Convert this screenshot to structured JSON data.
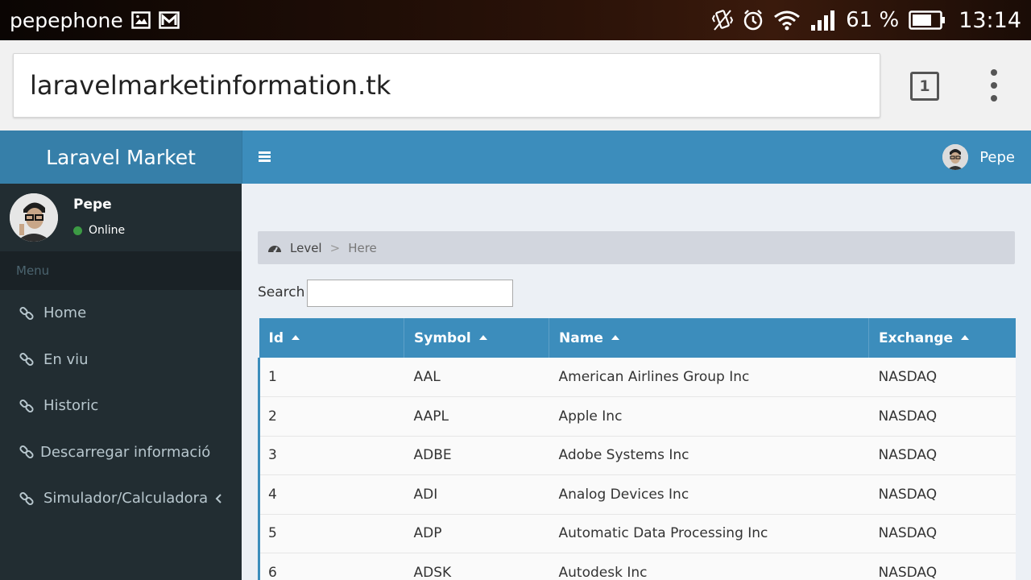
{
  "status_bar": {
    "carrier": "pepephone",
    "battery_percent": "61 %",
    "time": "13:14",
    "icons": [
      "image-icon",
      "gmail-icon",
      "vibrate-icon",
      "alarm-icon",
      "wifi-icon",
      "signal-icon",
      "battery-icon"
    ]
  },
  "browser": {
    "url": "laravelmarketinformation.tk",
    "tab_count": "1"
  },
  "header": {
    "logo": "Laravel Market",
    "user_name": "Pepe",
    "colors": {
      "logo_bg": "#367fa9",
      "navbar_bg": "#3c8dbc"
    }
  },
  "sidebar": {
    "user_name": "Pepe",
    "user_status": "Online",
    "menu_header": "Menu",
    "items": [
      {
        "label": "Home"
      },
      {
        "label": "En viu"
      },
      {
        "label": "Historic"
      },
      {
        "label": "Descarregar informació"
      },
      {
        "label": "Simulador/Calculadora"
      }
    ],
    "colors": {
      "bg": "#222d32",
      "text": "#b8c7ce"
    }
  },
  "breadcrumb": {
    "level": "Level",
    "separator": ">",
    "here": "Here"
  },
  "search": {
    "label": "Search",
    "value": ""
  },
  "table": {
    "columns": [
      "Id",
      "Symbol",
      "Name",
      "Exchange"
    ],
    "rows": [
      [
        "1",
        "AAL",
        "American Airlines Group Inc",
        "NASDAQ"
      ],
      [
        "2",
        "AAPL",
        "Apple Inc",
        "NASDAQ"
      ],
      [
        "3",
        "ADBE",
        "Adobe Systems Inc",
        "NASDAQ"
      ],
      [
        "4",
        "ADI",
        "Analog Devices Inc",
        "NASDAQ"
      ],
      [
        "5",
        "ADP",
        "Automatic Data Processing Inc",
        "NASDAQ"
      ],
      [
        "6",
        "ADSK",
        "Autodesk Inc",
        "NASDAQ"
      ]
    ]
  }
}
